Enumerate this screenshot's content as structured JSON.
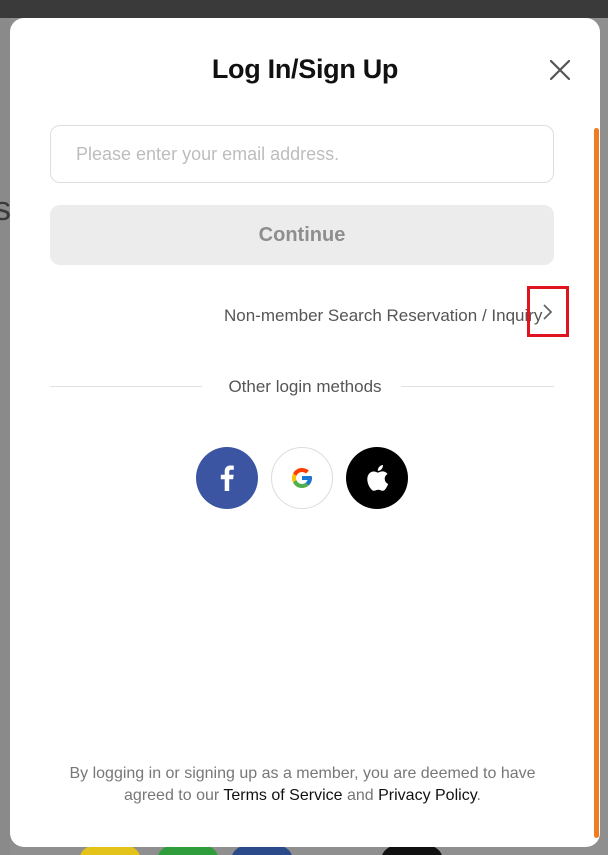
{
  "modal": {
    "title": "Log In/Sign Up",
    "close_icon": "close-icon"
  },
  "email": {
    "value": "",
    "placeholder": "Please enter your email address."
  },
  "continue_label": "Continue",
  "nonmember": {
    "label": "Non-member Search Reservation / Inquiry",
    "chevron_icon": "chevron-right-icon"
  },
  "other_login": {
    "label": "Other login methods",
    "providers": [
      {
        "name": "facebook",
        "icon": "facebook-icon",
        "color": "#3b55a3"
      },
      {
        "name": "google",
        "icon": "google-icon",
        "color": "#ffffff"
      },
      {
        "name": "apple",
        "icon": "apple-icon",
        "color": "#000000"
      }
    ]
  },
  "footer": {
    "text_before": "By logging in or signing up as a member, you are deemed to have agreed to our ",
    "terms": "Terms of Service",
    "and": " and ",
    "privacy": "Privacy Policy",
    "period": "."
  },
  "colors": {
    "accent_scrollbar": "#f07c21",
    "highlight_box": "#e0141e"
  }
}
